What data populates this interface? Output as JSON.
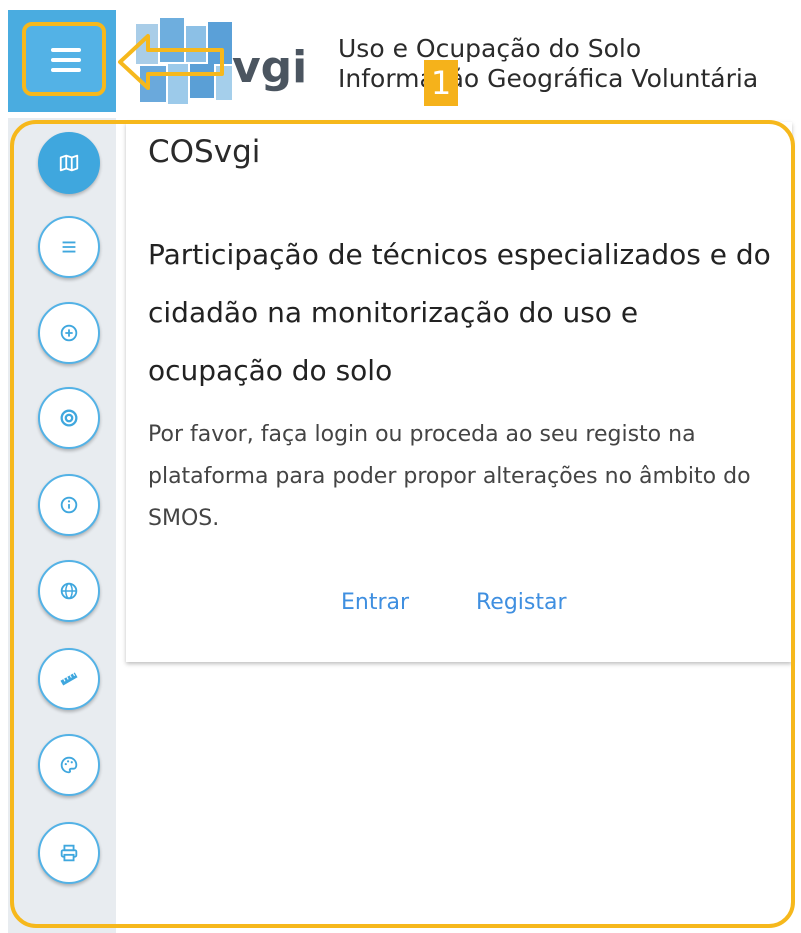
{
  "header": {
    "title_line1": "Uso e Ocupação do Solo",
    "title_line2": "Informação Geográfica Voluntária",
    "logo_text": "vgi",
    "step_badge": "1"
  },
  "sidebar": {
    "items": [
      {
        "icon": "map-icon",
        "active": true
      },
      {
        "icon": "list-icon",
        "active": false
      },
      {
        "icon": "plus-circle-icon",
        "active": false
      },
      {
        "icon": "target-icon",
        "active": false
      },
      {
        "icon": "info-icon",
        "active": false
      },
      {
        "icon": "globe-icon",
        "active": false
      },
      {
        "icon": "ruler-icon",
        "active": false
      },
      {
        "icon": "palette-icon",
        "active": false
      },
      {
        "icon": "print-icon",
        "active": false
      }
    ]
  },
  "card": {
    "title": "COSvgi",
    "heading": "Participação de técnicos especializados e do cidadão na monitorização do uso e ocupação do solo",
    "text": "Por favor, faça login ou proceda ao seu registo na plataforma para poder propor alterações no âmbito do SMOS.",
    "login_label": "Entrar",
    "register_label": "Registar"
  },
  "colors": {
    "accent": "#53b2e6",
    "highlight": "#f6b81c",
    "link": "#3f8fe0",
    "sidebar_bg": "#e8ecf0"
  }
}
